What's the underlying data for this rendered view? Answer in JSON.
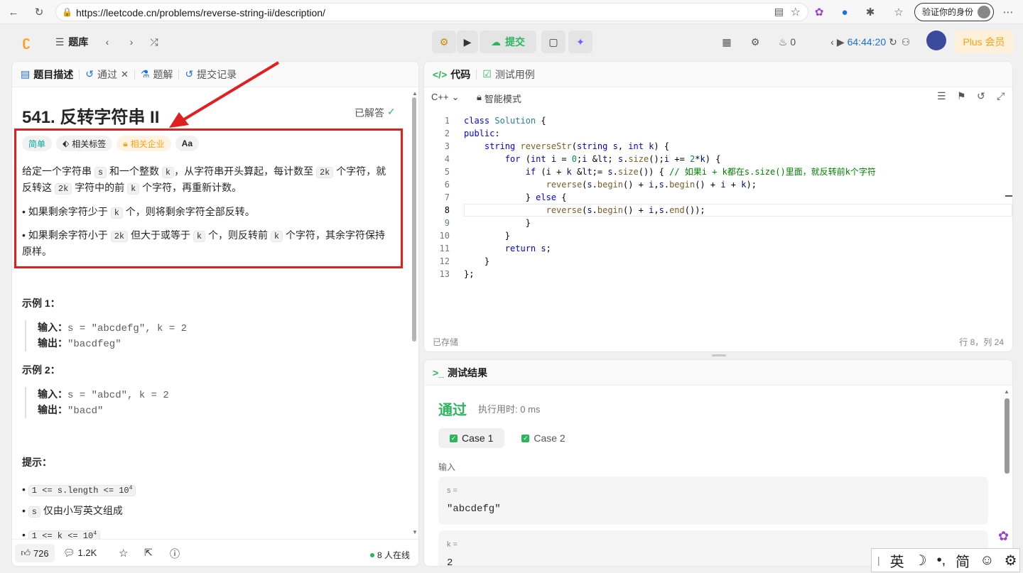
{
  "browser": {
    "url": "https://leetcode.cn/problems/reverse-string-ii/description/",
    "verify_label": "验证你的身份"
  },
  "header": {
    "problem_bank": "题库",
    "submit_label": "提交",
    "fire_count": "0",
    "timer": "64:44:20",
    "plus_label": "Plus 会员"
  },
  "left_tabs": [
    {
      "label": "题目描述"
    },
    {
      "label": "通过"
    },
    {
      "label": "题解"
    },
    {
      "label": "提交记录"
    }
  ],
  "problem": {
    "title": "541. 反转字符串 II",
    "solved_label": "已解答",
    "tags": {
      "difficulty": "简单",
      "topics": "相关标签",
      "companies": "相关企业",
      "font": "Aa"
    },
    "desc_1a": "给定一个字符串",
    "desc_s": "s",
    "desc_1b": "和一个整数",
    "desc_k": "k",
    "desc_1c": "，从字符串开头算起，每计数至",
    "desc_2k": "2k",
    "desc_1d": "个字符，就反转这",
    "desc_1e": "字符中的前",
    "desc_1f": "个字符，再重新计数。",
    "bullet1a": "如果剩余字符少于",
    "bullet1b": "个，则将剩余字符全部反转。",
    "bullet2a": "如果剩余字符小于",
    "bullet2b": "但大于或等于",
    "bullet2c": "个，则反转前",
    "bullet2d": "个字符，其余字符保持原样。",
    "example1_title": "示例 1：",
    "example2_title": "示例 2：",
    "input_label": "输入：",
    "output_label": "输出：",
    "ex1_in": "s = \"abcdefg\", k = 2",
    "ex1_out": "\"bacdfeg\"",
    "ex2_in": "s = \"abcd\", k = 2",
    "ex2_out": "\"bacd\"",
    "hints_title": "提示：",
    "hint1": "1 <= s.length <= 10",
    "hint2": "仅由小写英文组成",
    "hint3": "1 <= k <= 10",
    "sup": "4"
  },
  "footer": {
    "likes": "726",
    "comments": "1.2K",
    "online": "8 人在线"
  },
  "code_panel": {
    "tab_code": "代码",
    "tab_tests": "测试用例",
    "language": "C++",
    "mode": "智能模式",
    "saved": "已存储",
    "cursor": "行 8，列 24"
  },
  "code_lines": [
    "class Solution {",
    "public:",
    "    string reverseStr(string s, int k) {",
    "        for (int i = 0;i < s.size();i += 2*k) {",
    "            if (i + k <= s.size()) { // 如果i + k都在s.size()里面，就反转前k个字符",
    "                reverse(s.begin() + i,s.begin() + i + k);",
    "            } else {",
    "                reverse(s.begin() + i,s.end());",
    "            }",
    "        }",
    "        return s;",
    "    }",
    "};"
  ],
  "results": {
    "title": "测试结果",
    "status": "通过",
    "runtime": "执行用时: 0 ms",
    "cases": [
      "Case 1",
      "Case 2"
    ],
    "input_label": "输入",
    "var_s": "s =",
    "val_s": "\"abcdefg\"",
    "var_k": "k =",
    "val_k": "2"
  },
  "ime": {
    "lang": "英",
    "simp": "简"
  },
  "colors": {
    "accent_green": "#2db55d",
    "highlight_red": "#e02020",
    "plus_orange": "#ffa116"
  }
}
